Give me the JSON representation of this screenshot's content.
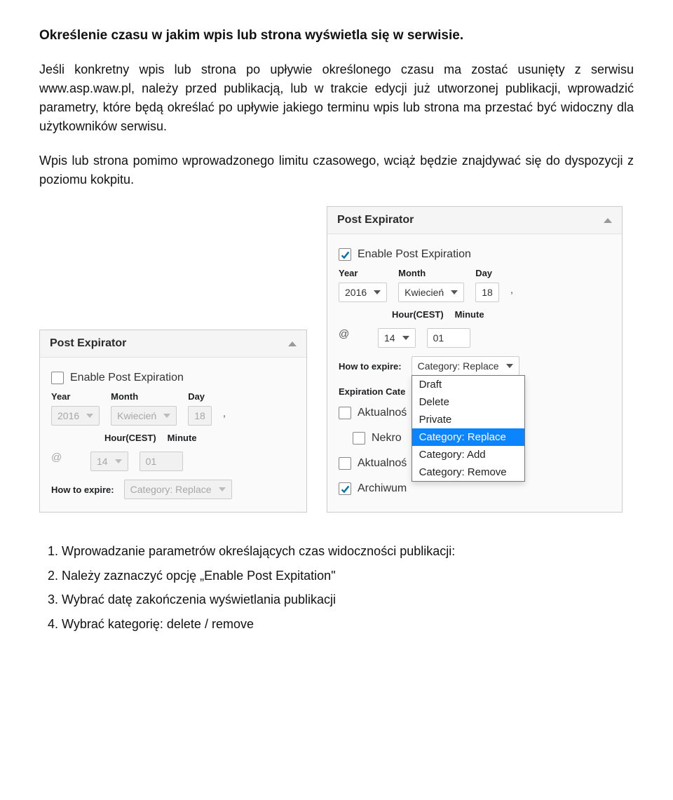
{
  "doc": {
    "heading": "Określenie czasu w jakim wpis lub strona wyświetla się w serwisie.",
    "p1": "Jeśli konkretny wpis lub strona po upływie określonego czasu ma zostać usunięty z serwisu www.asp.waw.pl, należy przed publikacją, lub w trakcie edycji już utworzonej publikacji, wprowadzić parametry, które będą określać po upływie jakiego terminu wpis lub strona ma przestać być widoczny dla użytkowników serwisu.",
    "p2": "Wpis lub strona pomimo wprowadzonego limitu czasowego, wciąż będzie znajdywać się do dyspozycji z poziomu kokpitu."
  },
  "panel": {
    "title": "Post Expirator",
    "enable_label": "Enable Post Expiration",
    "year_label": "Year",
    "month_label": "Month",
    "day_label": "Day",
    "hour_label": "Hour(CEST)",
    "minute_label": "Minute",
    "how_label": "How to expire:",
    "exp_cat_label": "Expiration Cate",
    "at": "@",
    "comma": ",",
    "shot1": {
      "enable_checked": false,
      "year": "2016",
      "month": "Kwiecień",
      "day": "18",
      "hour": "14",
      "minute": "01",
      "how": "Category: Replace"
    },
    "shot2": {
      "enable_checked": true,
      "year": "2016",
      "month": "Kwiecień",
      "day": "18",
      "hour": "14",
      "minute": "01",
      "how": "Category: Replace",
      "options": {
        "o0": "Draft",
        "o1": "Delete",
        "o2": "Private",
        "o3": "Category: Replace",
        "o4": "Category: Add",
        "o5": "Category: Remove"
      },
      "cats": {
        "c0_label": "Aktualnoś",
        "c0_checked": false,
        "c1_label": "Nekro",
        "c1_checked": false,
        "c2_label": "Aktualnoś",
        "c2_checked": false,
        "c3_label": "Archiwum",
        "c3_checked": true
      }
    }
  },
  "steps": {
    "s1": "Wprowadzanie parametrów określających czas widoczności publikacji:",
    "s2": "Należy zaznaczyć opcję „Enable Post Expitation\"",
    "s3": "Wybrać datę zakończenia wyświetlania publikacji",
    "s4": "Wybrać kategorię: delete / remove"
  }
}
